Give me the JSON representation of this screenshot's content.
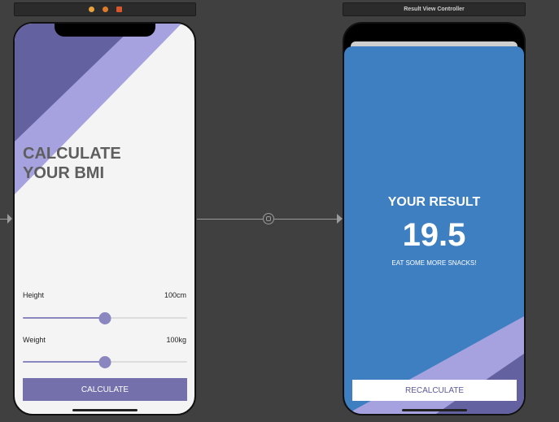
{
  "storyboard": {
    "right_scene_title": "Result View Controller",
    "scene_icons": [
      "view-controller-icon",
      "first-responder-icon",
      "exit-icon"
    ],
    "segue_icon": "segue-icon"
  },
  "calculate_screen": {
    "title": "CALCULATE\nYOUR BMI",
    "height_label": "Height",
    "height_value": "100cm",
    "height_slider_fraction": 0.5,
    "weight_label": "Weight",
    "weight_value": "100kg",
    "weight_slider_fraction": 0.5,
    "button_label": "CALCULATE"
  },
  "result_screen": {
    "title": "YOUR RESULT",
    "value": "19.5",
    "advice": "EAT SOME MORE SNACKS!",
    "button_label": "RECALCULATE"
  },
  "colors": {
    "canvas": "#404040",
    "purple_dark": "#6461a0",
    "purple_light": "#a6a2df",
    "button_purple": "#7470ac",
    "result_blue": "#3d7fc0"
  }
}
